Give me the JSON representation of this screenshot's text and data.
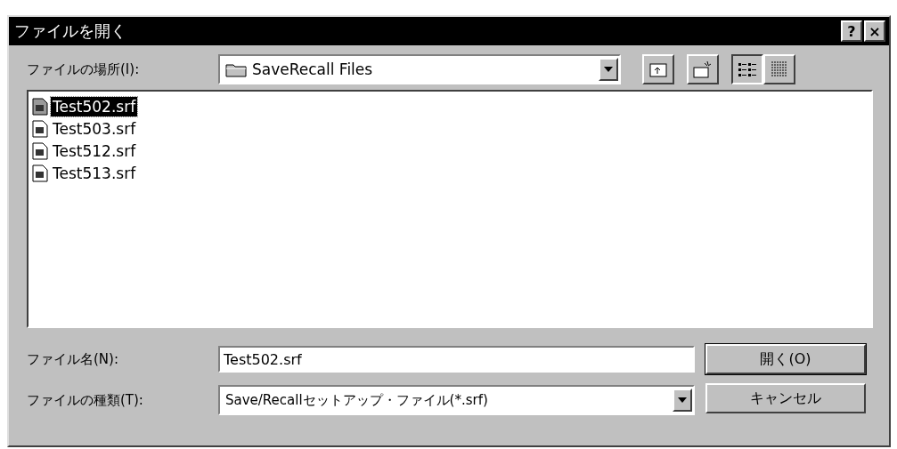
{
  "window": {
    "title": "ファイルを開く",
    "title_buttons": [
      "?",
      "×"
    ]
  },
  "location": {
    "label": "ファイルの場所(I):",
    "value": "SaveRecall Files"
  },
  "files": [
    {
      "name": "Test502.srf",
      "selected": true
    },
    {
      "name": "Test503.srf",
      "selected": false
    },
    {
      "name": "Test512.srf",
      "selected": false
    },
    {
      "name": "Test513.srf",
      "selected": false
    }
  ],
  "filename": {
    "label": "ファイル名(N):",
    "value": "Test502.srf"
  },
  "filetype": {
    "label": "ファイルの種類(T):",
    "value": "Save/Recallセットアップ・ファイル(*.srf)"
  },
  "buttons": [
    "開く(O)",
    "キャンセル"
  ]
}
